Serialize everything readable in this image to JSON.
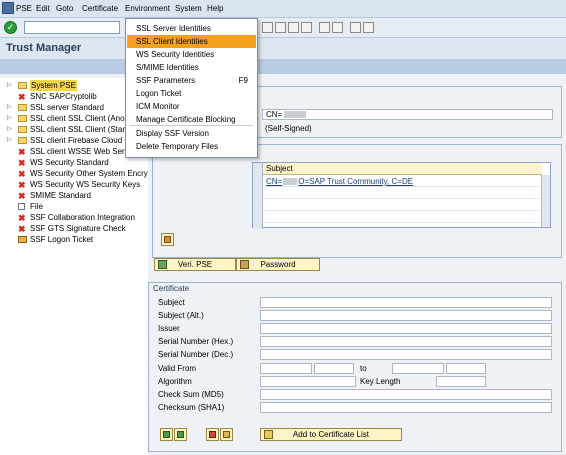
{
  "menubar": {
    "items": [
      "PSE",
      "Edit",
      "Goto",
      "Certificate",
      "Environment",
      "System",
      "Help"
    ]
  },
  "title": "Trust Manager",
  "environment_menu": {
    "items": [
      {
        "label": "SSL Server Identities",
        "shortcut": "",
        "highlighted": false
      },
      {
        "label": "SSL Client Identities",
        "shortcut": "",
        "highlighted": true
      },
      {
        "label": "WS Security Identities",
        "shortcut": "",
        "highlighted": false
      },
      {
        "label": "S/MIME Identities",
        "shortcut": "",
        "highlighted": false
      },
      {
        "label": "SSF Parameters",
        "shortcut": "F9",
        "highlighted": false
      },
      {
        "label": "Logon Ticket",
        "shortcut": "",
        "highlighted": false
      },
      {
        "label": "ICM Monitor",
        "shortcut": "",
        "highlighted": false
      },
      {
        "label": "Manage Certificate Blocking",
        "shortcut": "",
        "highlighted": false
      },
      {
        "label": "Display SSF Version",
        "shortcut": "",
        "highlighted": false
      },
      {
        "label": "Delete Temporary Files",
        "shortcut": "",
        "highlighted": false
      }
    ]
  },
  "tree": {
    "items": [
      {
        "label": "System PSE",
        "icon": "folder-icon",
        "selected": true,
        "expand": true
      },
      {
        "label": "SNC SAPCryptolib",
        "icon": "error-x-icon",
        "selected": false,
        "expand": false
      },
      {
        "label": "SSL server Standard",
        "icon": "folder-icon",
        "selected": false,
        "expand": true
      },
      {
        "label": "SSL client SSL Client (Anonym",
        "icon": "folder-icon",
        "selected": false,
        "expand": true
      },
      {
        "label": "SSL client SSL Client (Standa",
        "icon": "folder-icon",
        "selected": false,
        "expand": true
      },
      {
        "label": "SSL client Firebase Cloud me",
        "icon": "folder-icon",
        "selected": false,
        "expand": true
      },
      {
        "label": "SSL client WSSE Web Servic",
        "icon": "error-x-icon",
        "selected": false,
        "expand": false
      },
      {
        "label": "WS Security Standard",
        "icon": "error-x-icon",
        "selected": false,
        "expand": false
      },
      {
        "label": "WS Security Other System Encry",
        "icon": "error-x-icon",
        "selected": false,
        "expand": false
      },
      {
        "label": "WS Security WS Security Keys",
        "icon": "error-x-icon",
        "selected": false,
        "expand": false
      },
      {
        "label": "SMIME Standard",
        "icon": "error-x-icon",
        "selected": false,
        "expand": false
      },
      {
        "label": "File",
        "icon": "file-icon",
        "selected": false,
        "expand": false
      },
      {
        "label": "SSF Collaboration Integration",
        "icon": "error-x-icon",
        "selected": false,
        "expand": false
      },
      {
        "label": "SSF GTS Signature Check",
        "icon": "error-x-icon",
        "selected": false,
        "expand": false
      },
      {
        "label": "SSF Logon Ticket",
        "icon": "certificate-icon",
        "selected": false,
        "expand": false
      }
    ]
  },
  "owner": {
    "cn_value": "CN=",
    "self_signed": "(Self-Signed)"
  },
  "cert_list": {
    "column": "Subject",
    "row1_prefix": "CN=",
    "row1_suffix": "O=SAP Trust Community, C=DE"
  },
  "buttons": {
    "veri_pse": "Veri. PSE",
    "password": "Password",
    "add_to_list": "Add to Certificate List"
  },
  "certificate": {
    "group_title": "Certificate",
    "labels": {
      "subject": "Subject",
      "subject_alt": "Subject (Alt.)",
      "issuer": "Issuer",
      "serial_hex": "Serial Number (Hex.)",
      "serial_dec": "Serial Number (Dec.)",
      "valid_from": "Valid From",
      "to": "to",
      "algorithm": "Algorithm",
      "key_length": "Key Length",
      "checksum_md5": "Check Sum (MD5)",
      "checksum_sha1": "Checksum (SHA1)"
    }
  }
}
